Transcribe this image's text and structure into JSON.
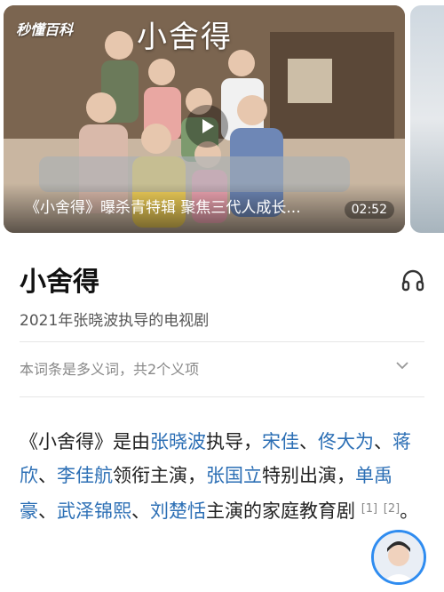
{
  "video": {
    "brand": "秒懂百科",
    "title_art": "小舍得",
    "caption": "《小舍得》曝杀青特辑 聚焦三代人成长...",
    "duration": "02:52"
  },
  "entry": {
    "title": "小舍得",
    "subtitle": "2021年张晓波执导的电视剧",
    "disambiguation": "本词条是多义词，共2个义项"
  },
  "summary": {
    "p1": "《小舍得》是由",
    "director": "张晓波",
    "p2": "执导，",
    "actor1": "宋佳",
    "sep1": "、",
    "actor2": "佟大为",
    "sep2": "、",
    "actor3": "蒋欣",
    "sep3": "、",
    "actor4": "李佳航",
    "p3": "领衔主演，",
    "special": "张国立",
    "p4": "特别出演，",
    "kid1": "单禹豪",
    "sep4": "、",
    "kid2": "武泽锦熙",
    "sep5": "、",
    "kid3": "刘楚恬",
    "p5": "主演的家庭教育剧",
    "ref1": "[1]",
    "ref2": "[2]",
    "p6": "。"
  },
  "colors": {
    "link": "#2c6fb5",
    "avatar_ring": "#2f8cf0"
  },
  "icons": {
    "play": "play-icon",
    "listen": "headphones-icon",
    "expand": "chevron-down-icon"
  }
}
